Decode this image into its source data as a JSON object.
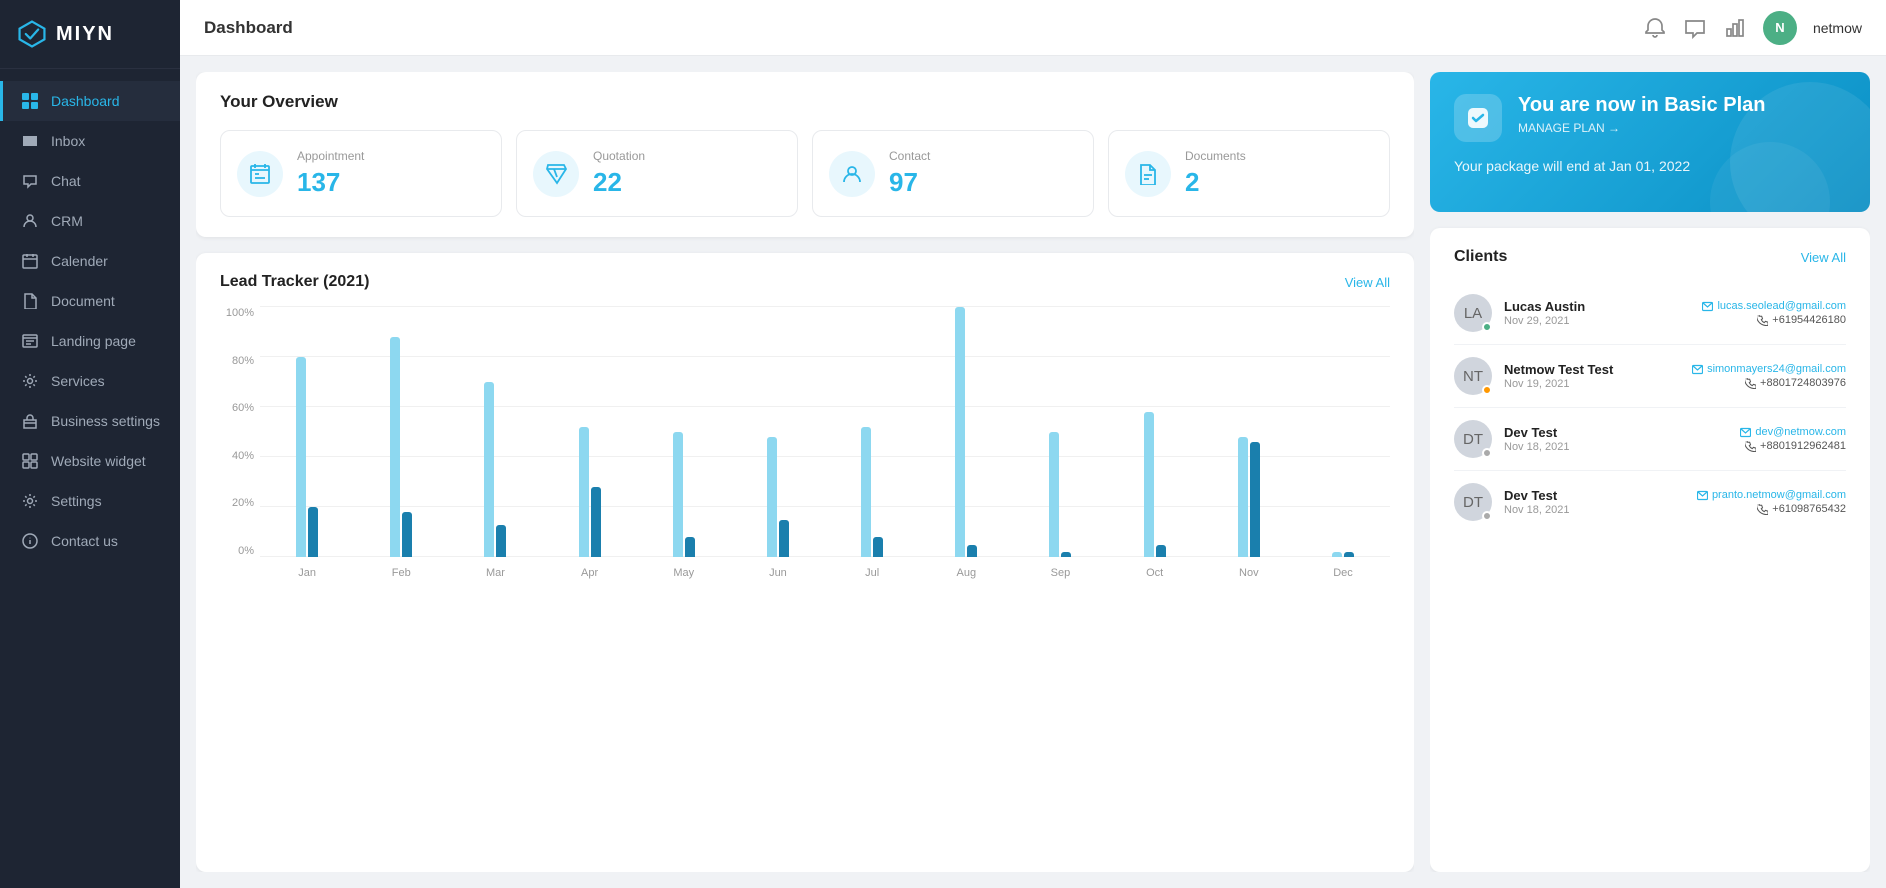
{
  "app": {
    "name": "MIYN"
  },
  "topbar": {
    "title": "Dashboard",
    "username": "netmow"
  },
  "sidebar": {
    "items": [
      {
        "id": "dashboard",
        "label": "Dashboard",
        "active": true
      },
      {
        "id": "inbox",
        "label": "Inbox",
        "active": false
      },
      {
        "id": "chat",
        "label": "Chat",
        "active": false
      },
      {
        "id": "crm",
        "label": "CRM",
        "active": false
      },
      {
        "id": "calender",
        "label": "Calender",
        "active": false
      },
      {
        "id": "document",
        "label": "Document",
        "active": false
      },
      {
        "id": "landing-page",
        "label": "Landing page",
        "active": false
      },
      {
        "id": "services",
        "label": "Services",
        "active": false
      },
      {
        "id": "business-settings",
        "label": "Business settings",
        "active": false
      },
      {
        "id": "website-widget",
        "label": "Website widget",
        "active": false
      },
      {
        "id": "settings",
        "label": "Settings",
        "active": false
      },
      {
        "id": "contact-us",
        "label": "Contact us",
        "active": false
      }
    ]
  },
  "overview": {
    "title": "Your Overview",
    "items": [
      {
        "label": "Appointment",
        "value": "137"
      },
      {
        "label": "Quotation",
        "value": "22"
      },
      {
        "label": "Contact",
        "value": "97"
      },
      {
        "label": "Documents",
        "value": "2"
      }
    ]
  },
  "lead_tracker": {
    "title": "Lead Tracker (2021)",
    "view_all": "View All",
    "y_labels": [
      "100%",
      "80%",
      "60%",
      "40%",
      "20%",
      "0%"
    ],
    "months": [
      "Jan",
      "Feb",
      "Mar",
      "Apr",
      "May",
      "Jun",
      "Jul",
      "Aug",
      "Sep",
      "Oct",
      "Nov",
      "Dec"
    ],
    "data_light": [
      80,
      88,
      70,
      52,
      50,
      48,
      52,
      100,
      50,
      58,
      48,
      2
    ],
    "data_dark": [
      20,
      18,
      13,
      28,
      8,
      15,
      8,
      5,
      2,
      5,
      46,
      2
    ]
  },
  "plan": {
    "title": "You are now in Basic Plan",
    "manage_label": "MANAGE PLAN →",
    "end_text": "Your package will end at Jan 01, 2022"
  },
  "clients": {
    "title": "Clients",
    "view_all": "View All",
    "items": [
      {
        "name": "Lucas Austin",
        "date": "Nov 29, 2021",
        "email": "lucas.seolead@gmail.com",
        "phone": "+61954426180",
        "status": "online"
      },
      {
        "name": "Netmow Test Test",
        "date": "Nov 19, 2021",
        "email": "simonmayers24@gmail.com",
        "phone": "+8801724803976",
        "status": "away"
      },
      {
        "name": "Dev Test",
        "date": "Nov 18, 2021",
        "email": "dev@netmow.com",
        "phone": "+8801912962481",
        "status": "offline"
      },
      {
        "name": "Dev Test",
        "date": "Nov 18, 2021",
        "email": "pranto.netmow@gmail.com",
        "phone": "+61098765432",
        "status": "offline"
      }
    ]
  }
}
